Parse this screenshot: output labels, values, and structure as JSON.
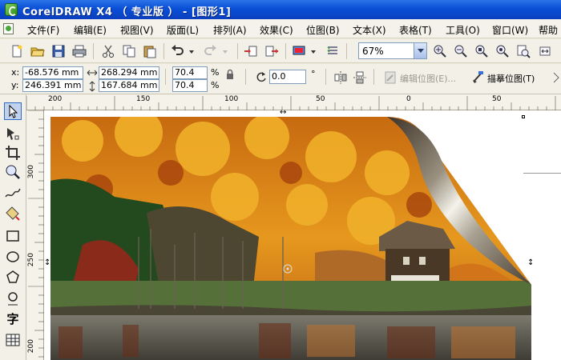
{
  "window": {
    "title": "CorelDRAW X4 （ 专业版 ） - [图形1]"
  },
  "menu": {
    "items": [
      "文件(F)",
      "编辑(E)",
      "视图(V)",
      "版面(L)",
      "排列(A)",
      "效果(C)",
      "位图(B)",
      "文本(X)",
      "表格(T)",
      "工具(O)",
      "窗口(W)",
      "帮助"
    ]
  },
  "toolbar": {
    "zoom": "67%"
  },
  "propbar": {
    "x_label": "x:",
    "x_value": "-68.576 mm",
    "y_label": "y:",
    "y_value": "246.391 mm",
    "width_value": "268.294 mm",
    "height_value": "167.684 mm",
    "scale_x": "70.4",
    "scale_y": "70.4",
    "percent": "%",
    "rotation": "0.0",
    "degree": "°",
    "edit_bitmap": "编辑位图(E)...",
    "trace_bitmap": "描摹位图(T)"
  },
  "ruler": {
    "h_ticks": [
      "200",
      "150",
      "100",
      "50",
      "0",
      "50"
    ],
    "v_ticks": [
      "300",
      "250",
      "200"
    ]
  },
  "toolbox": {
    "text_tool": "字"
  }
}
